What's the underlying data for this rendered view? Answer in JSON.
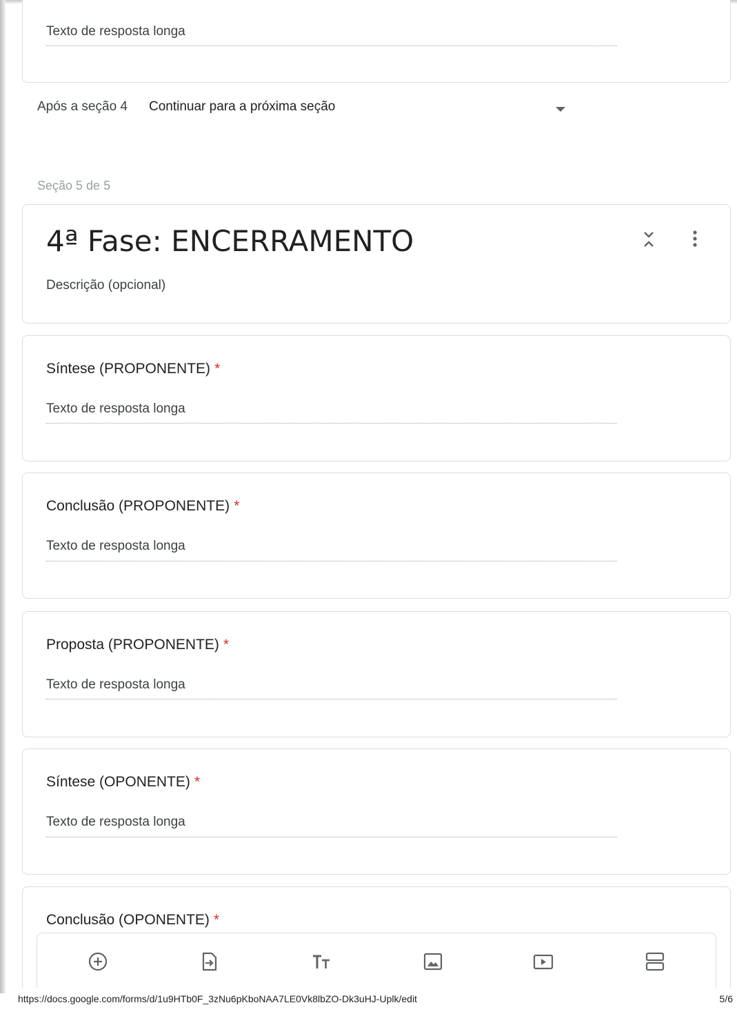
{
  "previous_question": {
    "answer_placeholder": "Texto de resposta longa"
  },
  "after_section": {
    "label": "Após a seção 4",
    "value": "Continuar para a próxima seção"
  },
  "section": {
    "counter": "Seção 5 de 5",
    "title": "4ª Fase: ENCERRAMENTO",
    "description_placeholder": "Descrição (opcional)"
  },
  "questions": [
    {
      "title": "Síntese (PROPONENTE)",
      "required_mark": "*",
      "answer_placeholder": "Texto de resposta longa"
    },
    {
      "title": "Conclusão (PROPONENTE)",
      "required_mark": "*",
      "answer_placeholder": "Texto de resposta longa"
    },
    {
      "title": "Proposta (PROPONENTE)",
      "required_mark": "*",
      "answer_placeholder": "Texto de resposta longa"
    },
    {
      "title": "Síntese (OPONENTE)",
      "required_mark": "*",
      "answer_placeholder": "Texto de resposta longa"
    },
    {
      "title": "Conclusão (OPONENTE)",
      "required_mark": "*"
    }
  ],
  "toolbar": {
    "items": [
      "add-question-icon",
      "import-questions-icon",
      "add-title-icon",
      "add-image-icon",
      "add-video-icon",
      "add-section-icon"
    ]
  },
  "footer": {
    "url": "https://docs.google.com/forms/d/1u9HTb0F_3zNu6pKboNAA7LE0Vk8lbZO-Dk3uHJ-Uplk/edit",
    "page": "5/6"
  },
  "colors": {
    "required": "#d93025",
    "muted": "#9aa0a6",
    "border": "#dadce0"
  }
}
